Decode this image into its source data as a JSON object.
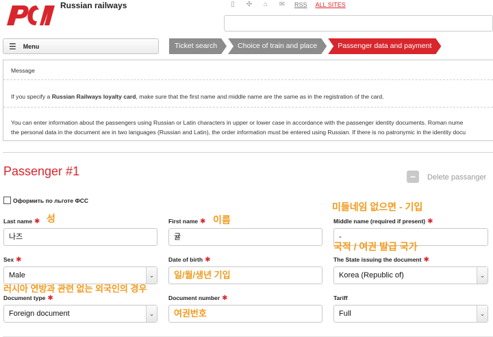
{
  "header": {
    "brand": "Russian railways",
    "rss": "RSS",
    "all_sites": "ALL SITES"
  },
  "menu": {
    "label": "Menu"
  },
  "steps": [
    {
      "label": "Ticket search"
    },
    {
      "label": "Choice of train and place"
    },
    {
      "label": "Passenger data and payment"
    }
  ],
  "message": {
    "title": "Message",
    "p1_before": "If you specify a ",
    "p1_bold": "Russian Railways loyalty card",
    "p1_after": ", make sure that the first name and middle name are the same as in the registration of the card.",
    "p2_line1": "You can enter information about the passengers using Russian or Latin characters in upper or lower case in accordance with the passenger identity documents. Roman nume",
    "p2_line2": "the personal data in the document are in two languages (Russian and Latin), the order information must be entered using Russian. If there is no patronymic in the identity docu"
  },
  "passenger": {
    "title": "Passenger #1",
    "delete_label": "Delete passanger",
    "benefit_label": "Оформить по льготе ФСС",
    "fields": {
      "last_name": {
        "label": "Last name",
        "value": "나즈"
      },
      "first_name": {
        "label": "First name",
        "value": "귤"
      },
      "middle_name": {
        "label": "Middle name (required if present)",
        "value": "-"
      },
      "sex": {
        "label": "Sex",
        "value": "Male"
      },
      "dob": {
        "label": "Date of birth",
        "value": "일/월/생년 기입"
      },
      "state": {
        "label": "The State issuing the document",
        "value": "Korea (Republic of)"
      },
      "doc_type": {
        "label": "Document type",
        "value": "Foreign document"
      },
      "doc_number": {
        "label": "Document number",
        "value": "여권번호"
      },
      "tariff": {
        "label": "Tariff",
        "value": "Full"
      }
    }
  },
  "annotations": {
    "last_name": "성",
    "first_name": "이름",
    "middle_name": "미들네임 없으면 - 기입",
    "state": "국적 / 여권 발급 국가",
    "doc_type": "러시아 연방과 관련 없는 외국인의 경우"
  },
  "colors": {
    "accent": "#d8262c",
    "step_done": "#8c8c8c",
    "annotation": "#f29a1c"
  }
}
